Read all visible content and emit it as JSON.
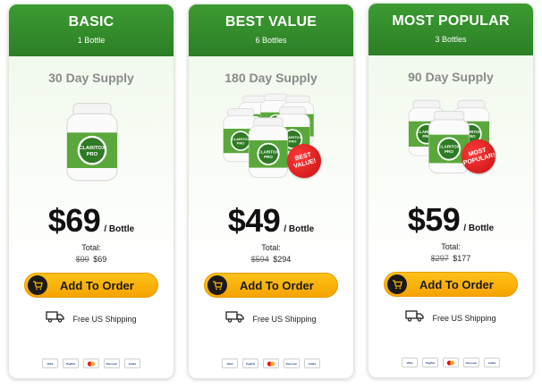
{
  "cards": [
    {
      "plan": "BASIC",
      "bottles_count": "1 Bottle",
      "supply": "30 Day Supply",
      "price": "$69",
      "per": "/ Bottle",
      "total_label": "Total:",
      "old_total": "$99",
      "new_total": "$69",
      "button": "Add To Order",
      "shipping": "Free US Shipping"
    },
    {
      "plan": "BEST VALUE",
      "bottles_count": "6 Bottles",
      "supply": "180 Day Supply",
      "badge": "BEST VALUE!",
      "price": "$49",
      "per": "/ Bottle",
      "total_label": "Total:",
      "old_total": "$594",
      "new_total": "$294",
      "button": "Add To Order",
      "shipping": "Free US Shipping"
    },
    {
      "plan": "MOST POPULAR",
      "bottles_count": "3 Bottles",
      "supply": "90 Day Supply",
      "badge": "MOST POPULAR!",
      "price": "$59",
      "per": "/ Bottle",
      "total_label": "Total:",
      "old_total": "$297",
      "new_total": "$177",
      "button": "Add To Order",
      "shipping": "Free US Shipping"
    }
  ],
  "product_label": "CLARITOX PRO",
  "payment_methods": [
    "VISA",
    "PayPal",
    "Mastercard",
    "Discover",
    "AmEx"
  ],
  "colors": {
    "header_green": "#2f8a28",
    "button_yellow": "#f9b40c",
    "badge_red": "#d41414",
    "price_black": "#111111"
  }
}
